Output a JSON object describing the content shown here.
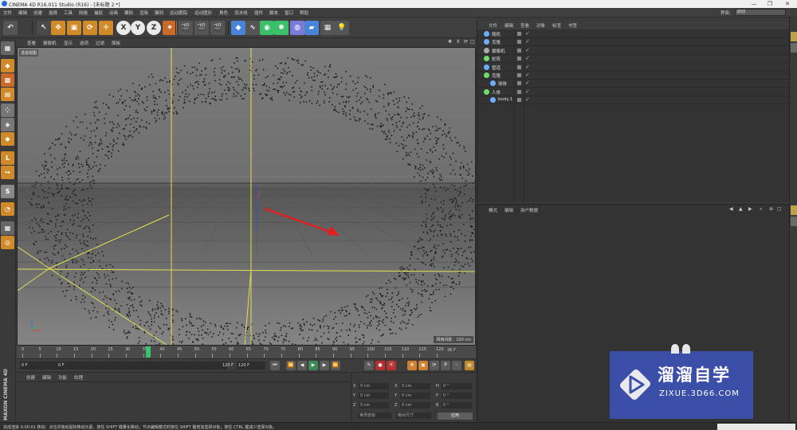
{
  "window": {
    "title": "CINEMA 4D R16.011 Studio (R16) - [未标题 2 *]",
    "controls": [
      "—",
      "❐",
      "✕"
    ]
  },
  "menubar": {
    "items": [
      "文件",
      "编辑",
      "创建",
      "选择",
      "工具",
      "网格",
      "捕捉",
      "动画",
      "模拟",
      "渲染",
      "雕刻",
      "运动跟踪",
      "运动图形",
      "角色",
      "流水线",
      "插件",
      "脚本",
      "窗口",
      "帮助"
    ],
    "layout_label": "界面:",
    "layout_value": "启动"
  },
  "toolbar": {
    "buttons": [
      {
        "name": "undo",
        "glyph": "↶"
      },
      {
        "name": "live-select",
        "glyph": "↖"
      },
      {
        "name": "move",
        "glyph": "✥"
      },
      {
        "name": "scale",
        "glyph": "▣"
      },
      {
        "name": "rotate",
        "glyph": "⟳"
      },
      {
        "name": "recent-tool",
        "glyph": "✛"
      },
      {
        "name": "axis-x",
        "glyph": "X"
      },
      {
        "name": "axis-y",
        "glyph": "Y"
      },
      {
        "name": "axis-z",
        "glyph": "Z"
      },
      {
        "name": "coordinate-system",
        "glyph": "⌖"
      },
      {
        "name": "render-view",
        "glyph": "🎬"
      },
      {
        "name": "render-picture-viewer",
        "glyph": "🎬"
      },
      {
        "name": "edit-render-settings",
        "glyph": "🎬"
      },
      {
        "name": "cube",
        "glyph": "◆"
      },
      {
        "name": "spline",
        "glyph": "∿"
      },
      {
        "name": "nurbs",
        "glyph": "◉"
      },
      {
        "name": "array",
        "glyph": "✺"
      },
      {
        "name": "deformer",
        "glyph": "◍"
      },
      {
        "name": "floor",
        "glyph": "▰"
      },
      {
        "name": "camera",
        "glyph": "▦"
      },
      {
        "name": "light",
        "glyph": "💡"
      }
    ]
  },
  "viewport": {
    "menu": [
      "查看",
      "摄像机",
      "显示",
      "选项",
      "过滤",
      "面板"
    ],
    "view_label": "透视视图",
    "grid_scale": "网格间距 : 100 cm"
  },
  "timeline": {
    "ticks": [
      "0",
      "5",
      "10",
      "15",
      "20",
      "25",
      "30",
      "35",
      "40",
      "45",
      "50",
      "55",
      "60",
      "65",
      "70",
      "75",
      "80",
      "85",
      "90",
      "95",
      "100",
      "105",
      "110",
      "115",
      "120"
    ],
    "end_frame": "36 F",
    "current_frame_pct": 0.3
  },
  "transport": {
    "start": "0 F",
    "current": "0 F",
    "end_a": "120 F",
    "end_b": "120 F"
  },
  "material_panel": {
    "menu": [
      "创建",
      "编辑",
      "功能",
      "纹理"
    ]
  },
  "coordinates": {
    "rows": [
      {
        "a": "X",
        "v1": "0 cm",
        "b": "X",
        "v2": "0 cm",
        "c": "H",
        "v3": "0 °"
      },
      {
        "a": "Y",
        "v1": "0 cm",
        "b": "Y",
        "v2": "0 cm",
        "c": "P",
        "v3": "0 °"
      },
      {
        "a": "Z",
        "v1": "0 cm",
        "b": "Z",
        "v2": "0 cm",
        "c": "B",
        "v3": "0 °"
      }
    ],
    "mode_a": "世界坐标",
    "mode_b": "绝对尺寸",
    "apply": "应用"
  },
  "object_manager": {
    "menu": [
      "文件",
      "编辑",
      "查看",
      "对象",
      "标签",
      "书签"
    ],
    "objects": [
      {
        "name": "随机",
        "indent": 0,
        "icon_color": "#6ab0ff"
      },
      {
        "name": "克隆",
        "indent": 0,
        "icon_color": "#6ab0ff"
      },
      {
        "name": "摄像机",
        "indent": 0,
        "icon_color": "#aaaaaa"
      },
      {
        "name": "矩阵",
        "indent": 0,
        "icon_color": "#6adf6a"
      },
      {
        "name": "管道",
        "indent": 0,
        "icon_color": "#6ab0ff"
      },
      {
        "name": "克隆",
        "indent": 0,
        "icon_color": "#6adf6a"
      },
      {
        "name": "球体",
        "indent": 1,
        "icon_color": "#6ab0ff"
      },
      {
        "name": "人体",
        "indent": 0,
        "icon_color": "#6adf6a"
      },
      {
        "name": "body.1",
        "indent": 1,
        "icon_color": "#6ab0ff"
      }
    ]
  },
  "attribute_manager": {
    "menu": [
      "模式",
      "编辑",
      "用户数据"
    ]
  },
  "status": {
    "text": "完成渲染    0:00:01    移动：点击并拖动鼠标移动元素。按住 SHIFT 键量化移动；节点编辑模式时按住 SHIFT 键增加选择对象；按住 CTRL 键减少选择对象。"
  },
  "branding": {
    "maxon": "MAXON CINEMA 4D"
  },
  "watermark": {
    "cn": "溜溜自学",
    "en": "ZIXUE.3D66.COM"
  },
  "colors": {
    "accent": "#4a84d8",
    "play": "#39c36b",
    "record": "#e04040"
  }
}
